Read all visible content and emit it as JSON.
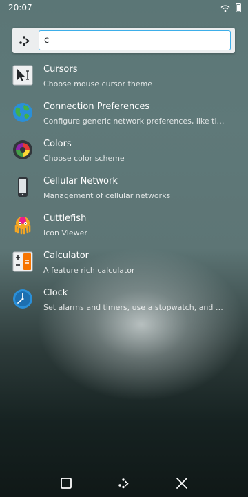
{
  "status_bar": {
    "time": "20:07",
    "icons": [
      "wifi-icon",
      "battery-icon"
    ]
  },
  "search": {
    "value": "c",
    "icon": "krunner-icon"
  },
  "colors": {
    "accent": "#3daee9"
  },
  "results": [
    {
      "title": "Cursors",
      "subtitle": "Choose mouse cursor theme",
      "icon": "cursors-icon"
    },
    {
      "title": "Connection Preferences",
      "subtitle": "Configure generic network preferences, like timeouts",
      "icon": "globe-icon"
    },
    {
      "title": "Colors",
      "subtitle": "Choose color scheme",
      "icon": "color-wheel-icon"
    },
    {
      "title": "Cellular Network",
      "subtitle": "Management of cellular networks",
      "icon": "phone-icon"
    },
    {
      "title": "Cuttlefish",
      "subtitle": "Icon Viewer",
      "icon": "cuttlefish-icon"
    },
    {
      "title": "Calculator",
      "subtitle": "A feature rich calculator",
      "icon": "calculator-icon"
    },
    {
      "title": "Clock",
      "subtitle": "Set alarms and timers, use a stopwatch, and manage world clocks",
      "icon": "clock-icon"
    }
  ],
  "nav_bar": {
    "buttons": [
      "task-switcher-icon",
      "krunner-icon",
      "close-icon"
    ]
  }
}
